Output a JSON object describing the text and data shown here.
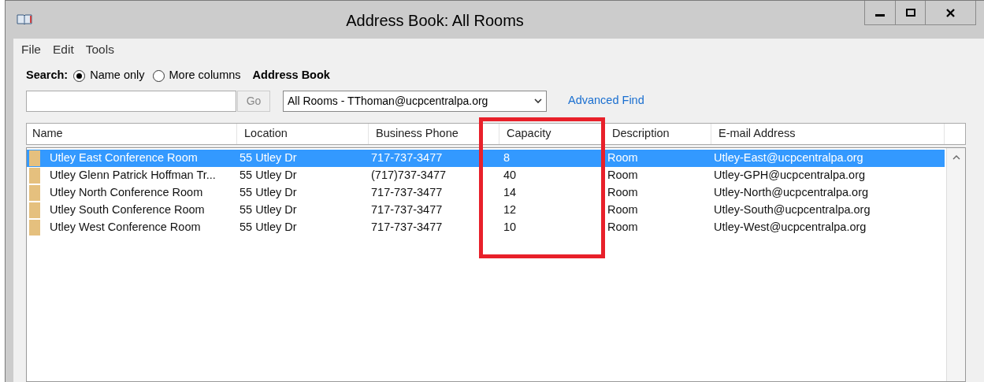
{
  "window": {
    "title": "Address Book: All Rooms",
    "controls": [
      {
        "kind": "minimize"
      },
      {
        "kind": "maximize"
      },
      {
        "kind": "close"
      }
    ]
  },
  "menu": [
    "File",
    "Edit",
    "Tools"
  ],
  "search": {
    "label": "Search:",
    "options": [
      {
        "label": "Name only",
        "selected": true
      },
      {
        "label": "More columns",
        "selected": false
      }
    ],
    "go": "Go"
  },
  "address_book": {
    "label": "Address Book",
    "value": "All Rooms - TThoman@ucpcentralpa.org",
    "advanced_find": "Advanced Find"
  },
  "table": {
    "columns": [
      "Name",
      "Location",
      "Business Phone",
      "Capacity",
      "Description",
      "E-mail Address"
    ],
    "rows": [
      {
        "selected": true,
        "cells": [
          "Utley East Conference Room",
          "55 Utley Dr",
          "717-737-3477",
          "8",
          "Room",
          "Utley-East@ucpcentralpa.org"
        ]
      },
      {
        "selected": false,
        "cells": [
          "Utley Glenn Patrick Hoffman Tr...",
          "55 Utley Dr",
          "(717)737-3477",
          "40",
          "Room",
          "Utley-GPH@ucpcentralpa.org"
        ]
      },
      {
        "selected": false,
        "cells": [
          "Utley North Conference Room",
          "55 Utley Dr",
          "717-737-3477",
          "14",
          "Room",
          "Utley-North@ucpcentralpa.org"
        ]
      },
      {
        "selected": false,
        "cells": [
          "Utley South Conference Room",
          "55 Utley Dr",
          "717-737-3477",
          "12",
          "Room",
          "Utley-South@ucpcentralpa.org"
        ]
      },
      {
        "selected": false,
        "cells": [
          "Utley West Conference Room",
          "55 Utley Dr",
          "717-737-3477",
          "10",
          "Room",
          "Utley-West@ucpcentralpa.org"
        ]
      }
    ]
  }
}
